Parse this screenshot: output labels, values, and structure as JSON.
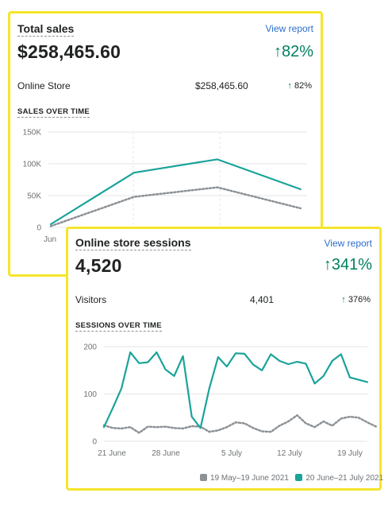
{
  "sales_card": {
    "title": "Total sales",
    "link": "View report",
    "total": "$258,465.60",
    "change": "82%",
    "row": {
      "label": "Online Store",
      "value": "$258,465.60",
      "change": "82%"
    },
    "section_title": "SALES OVER TIME"
  },
  "sessions_card": {
    "title": "Online store sessions",
    "link": "View report",
    "total": "4,520",
    "change": "341%",
    "row": {
      "label": "Visitors",
      "value": "4,401",
      "change": "376%"
    },
    "section_title": "SESSIONS OVER TIME",
    "legend": {
      "previous": "19 May–19 June 2021",
      "current": "20 June–21 July 2021"
    }
  },
  "colors": {
    "current": "#1aa39a",
    "previous": "#8c9196",
    "accent": "#008060",
    "highlight_border": "#f5e52b"
  },
  "chart_data": [
    {
      "type": "line",
      "title": "SALES OVER TIME",
      "y_ticks": [
        "0",
        "50K",
        "100K",
        "150K"
      ],
      "ylim": [
        0,
        150000
      ],
      "x_labels": [
        "Jun"
      ],
      "series": [
        {
          "name": "current",
          "style": "solid",
          "values": [
            5000,
            86000,
            107000,
            60000
          ]
        },
        {
          "name": "previous",
          "style": "dotted",
          "values": [
            2000,
            48000,
            63000,
            30000
          ]
        }
      ]
    },
    {
      "type": "line",
      "title": "SESSIONS OVER TIME",
      "y_ticks": [
        "0",
        "100",
        "200"
      ],
      "ylim": [
        0,
        200
      ],
      "x_ticks": [
        "21 June",
        "28 June",
        "5 July",
        "12 July",
        "19 July"
      ],
      "series": [
        {
          "name": "20 June–21 July 2021",
          "style": "solid",
          "values": [
            30,
            70,
            112,
            188,
            165,
            167,
            188,
            152,
            138,
            180,
            52,
            28,
            112,
            178,
            158,
            186,
            185,
            162,
            150,
            184,
            170,
            163,
            168,
            164,
            122,
            138,
            170,
            184,
            135,
            130,
            125
          ]
        },
        {
          "name": "19 May–19 June 2021",
          "style": "dotted",
          "values": [
            34,
            28,
            27,
            30,
            18,
            31,
            30,
            31,
            28,
            27,
            32,
            31,
            20,
            23,
            30,
            40,
            38,
            28,
            21,
            20,
            33,
            42,
            55,
            38,
            30,
            42,
            33,
            48,
            52,
            50,
            40,
            31
          ]
        }
      ]
    }
  ]
}
